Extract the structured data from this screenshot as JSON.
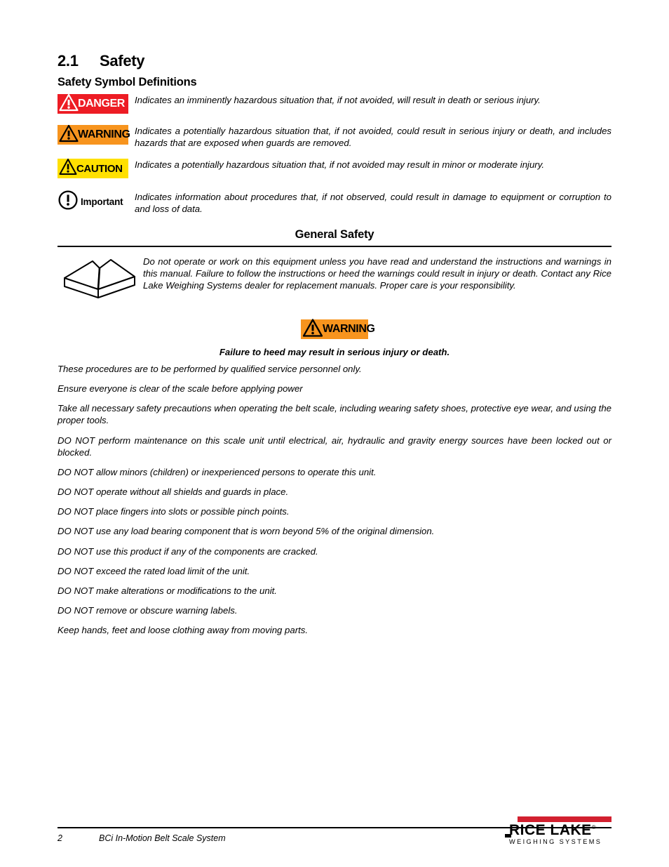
{
  "heading": {
    "number": "2.1",
    "title": "Safety",
    "subtitle": "Safety Symbol Definitions"
  },
  "symbols": [
    {
      "badge": "DANGER",
      "icon": "warning-triangle-icon",
      "style": "danger",
      "description": "Indicates an imminently hazardous situation that, if not avoided, will result in death or serious injury."
    },
    {
      "badge": "WARNING",
      "icon": "warning-triangle-icon",
      "style": "warning",
      "description": "Indicates a potentially hazardous situation that, if not avoided, could result in serious injury or death, and includes hazards that are exposed when guards are removed."
    },
    {
      "badge": "CAUTION",
      "icon": "warning-triangle-icon",
      "style": "caution",
      "description": "Indicates a potentially hazardous situation that, if not avoided may result in minor or moderate injury."
    },
    {
      "badge": "Important",
      "icon": "exclamation-circle-icon",
      "style": "important",
      "description": "Indicates information about procedures that, if not observed, could result in damage to equipment or corruption to and loss of data."
    }
  ],
  "general_safety": {
    "title": "General Safety",
    "icon": "open-book-icon",
    "intro": "Do not operate or work on this equipment unless you have read and understand the instructions and warnings in this manual. Failure to follow the instructions or heed the warnings could result in injury or death. Contact any Rice Lake Weighing Systems dealer for replacement manuals. Proper care is your responsibility.",
    "callout_badge": "WARNING",
    "callout_text": "Failure to heed may result in serious injury or death.",
    "rules": [
      "These procedures are to be performed by qualified service personnel only.",
      "Ensure everyone is clear of the scale before applying power",
      "Take all necessary safety precautions when operating the belt scale, including wearing safety shoes, protective eye wear, and using the proper tools.",
      "DO NOT perform maintenance on this scale unit until electrical, air, hydraulic and gravity energy sources have been locked out or blocked.",
      "DO NOT allow minors (children) or inexperienced persons to operate this unit.",
      "DO NOT operate without all shields and guards in place.",
      "DO NOT place fingers into slots or possible pinch points.",
      "DO NOT use any load bearing component that is worn beyond 5% of the original dimension.",
      "DO NOT use this product if any of the components are cracked.",
      "DO NOT exceed the rated load limit of the unit.",
      "DO NOT make alterations or modifications to the unit.",
      "DO NOT remove or obscure warning labels.",
      "Keep hands, feet and loose clothing away from moving parts."
    ]
  },
  "footer": {
    "page_number": "2",
    "document_title": "BCi In-Motion Belt Scale System",
    "logo_name": "RICE LAKE",
    "logo_registered": "®",
    "logo_tagline": "WEIGHING SYSTEMS"
  },
  "colors": {
    "danger_red": "#ED1C24",
    "warning_orange": "#F7941E",
    "caution_yellow": "#FFE000",
    "logo_red": "#D2202F"
  }
}
